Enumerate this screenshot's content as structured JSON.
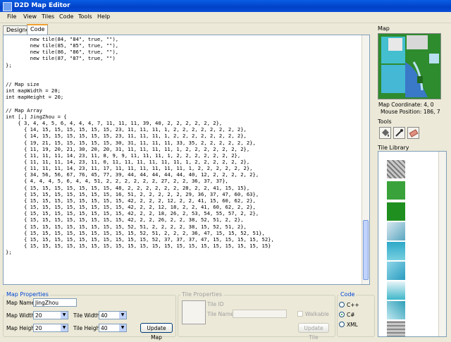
{
  "window": {
    "title": "D2D Map Editor"
  },
  "menu": [
    "File",
    "View",
    "Tiles",
    "Code",
    "Tools",
    "Help"
  ],
  "tabs": {
    "designer": "Designer",
    "code": "Code"
  },
  "code_lines": [
    "        new tile(84, \"84\", true, \"\"),",
    "        new tile(85, \"85\", true, \"\"),",
    "        new tile(86, \"86\", true, \"\"),",
    "        new tile(87, \"87\", true, \"\")",
    "};",
    "",
    "",
    "// Map size",
    "int mapWidth = 20;",
    "int mapHeight = 20;",
    "",
    "// Map Array",
    "int [,] JingZhou = {",
    "    { 3, 4, 4, 5, 6, 4, 4, 4, 7, 11, 11, 11, 39, 40, 2, 2, 2, 2, 2, 2},",
    "      { 14, 15, 15, 15, 15, 15, 15, 23, 11, 11, 11, 1, 2, 2, 2, 2, 2, 2, 2, 2},",
    "      { 14, 15, 15, 15, 15, 15, 15, 23, 11, 11, 11, 1, 2, 2, 2, 2, 2, 2, 2, 2},",
    "      { 19, 21, 15, 15, 15, 15, 15, 30, 31, 11, 11, 11, 33, 35, 2, 2, 2, 2, 2, 2},",
    "      { 11, 19, 20, 21, 30, 20, 20, 31, 11, 11, 11, 11, 1, 2, 2, 2, 2, 2, 2, 2},",
    "      { 11, 11, 11, 14, 23, 11, 8, 9, 9, 11, 11, 11, 1, 2, 2, 2, 2, 2, 2, 2},",
    "      { 11, 11, 11, 14, 23, 11, 0, 11, 11, 11, 11, 11, 11, 1, 2, 2, 2, 2, 2, 2},",
    "      { 11, 11, 11, 14, 23, 11, 17, 11, 11, 11, 11, 11, 11, 1, 2, 2, 2, 2, 2, 2},",
    "      { 34, 56, 56, 67, 76, 45, 77, 39, 44, 44, 44, 44, 44, 40, 12, 2, 2, 2, 2, 2},",
    "      { 4, 4, 4, 5, 6, 4, 4, 51, 2, 2, 2, 2, 2, 2, 27, 2, 2, 36, 37, 37},",
    "      { 15, 15, 15, 15, 15, 15, 15, 48, 2, 2, 2, 2, 2, 2, 28, 2, 2, 41, 15, 15},",
    "      { 15, 15, 15, 15, 15, 15, 15, 16, 51, 2, 2, 2, 2, 2, 29, 36, 37, 47, 60, 63},",
    "      { 15, 15, 15, 15, 15, 15, 15, 15, 42, 2, 2, 2, 12, 2, 2, 41, 15, 60, 62, 2},",
    "      { 15, 15, 15, 15, 15, 15, 15, 15, 42, 2, 2, 12, 18, 2, 2, 41, 60, 62, 2, 2},",
    "      { 15, 15, 15, 15, 15, 15, 15, 15, 42, 2, 2, 18, 26, 2, 53, 54, 55, 57, 2, 2},",
    "      { 15, 15, 15, 15, 15, 15, 15, 15, 42, 2, 2, 26, 2, 2, 38, 52, 51, 2, 2},",
    "      { 15, 15, 15, 15, 15, 15, 15, 15, 52, 51, 2, 2, 2, 2, 38, 15, 52, 51, 2},",
    "      { 15, 15, 15, 15, 15, 15, 15, 15, 15, 52, 51, 2, 2, 2, 36, 47, 15, 15, 52, 51},",
    "      { 15, 15, 15, 15, 15, 15, 15, 15, 15, 15, 52, 37, 37, 37, 47, 15, 15, 15, 15, 52},",
    "      { 15, 15, 15, 15, 15, 15, 15, 15, 15, 15, 15, 15, 15, 15, 15, 15, 15, 15, 15, 15}",
    "};"
  ],
  "map_panel": {
    "title": "Map",
    "coordinate": "Map Coordinate: 4, 0",
    "mouse_position": "Mouse Position: 186, 7"
  },
  "tools_panel": {
    "title": "Tools",
    "tools": [
      "paint-bucket-icon",
      "eyedropper-icon",
      "eraser-icon"
    ]
  },
  "tile_library": {
    "title": "Tile Library"
  },
  "map_properties": {
    "title": "Map Properties",
    "map_name_label": "Map Name",
    "map_name_value": "JingZhou",
    "map_width_label": "Map Width",
    "map_width_value": "20",
    "map_height_label": "Map Height",
    "map_height_value": "20",
    "tile_width_label": "Tile Width",
    "tile_width_value": "40",
    "tile_height_label": "Tile Height",
    "tile_height_value": "40",
    "update_button": "Update Map"
  },
  "tile_properties": {
    "title": "Tile Properties",
    "tile_id_label": "Tile ID",
    "tile_name_label": "Tile Name",
    "walkable_label": "Walkable",
    "update_button": "Update Tile"
  },
  "code_panel": {
    "title": "Code",
    "options": [
      "C++",
      "C#",
      "XML"
    ],
    "selected": "C#"
  },
  "colors": {
    "title_blue": "#0041c8",
    "accent": "#0046d5",
    "grass": "#2f8f2f",
    "water": "#3fb7c9"
  }
}
